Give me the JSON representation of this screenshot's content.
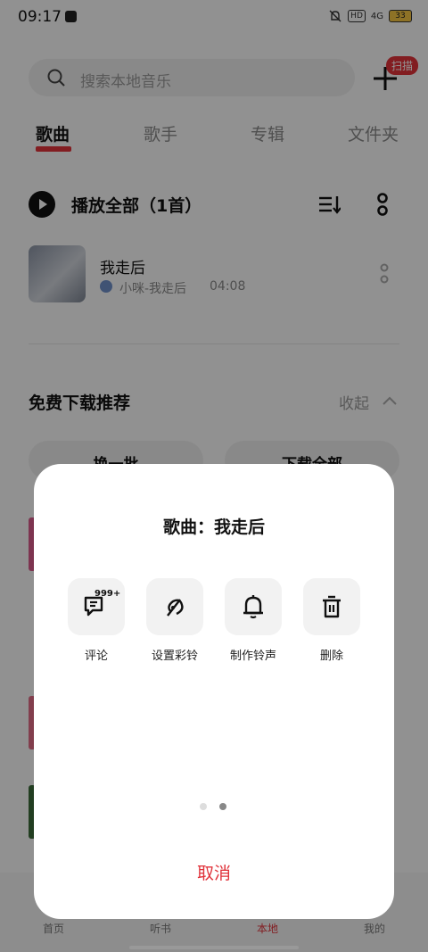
{
  "status_bar": {
    "time": "09:17",
    "hd": "HD",
    "network": "4G",
    "battery": "33"
  },
  "search": {
    "placeholder": "搜索本地音乐",
    "scan_badge": "扫描"
  },
  "tabs": [
    {
      "label": "歌曲"
    },
    {
      "label": "歌手"
    },
    {
      "label": "专辑"
    },
    {
      "label": "文件夹"
    }
  ],
  "play_all": {
    "label": "播放全部（1首）"
  },
  "song": {
    "title": "我走后",
    "artist": "小咪-我走后",
    "duration": "04:08"
  },
  "recommend": {
    "title": "免费下载推荐",
    "collapse_label": "收起",
    "buttons": [
      "换一批",
      "下载全部"
    ]
  },
  "bottom_nav": [
    {
      "label": "首页"
    },
    {
      "label": "听书"
    },
    {
      "label": "本地"
    },
    {
      "label": "我的"
    }
  ],
  "sheet": {
    "title": "歌曲：我走后",
    "actions": [
      {
        "label": "评论",
        "icon": "comment-icon",
        "badge": "999+"
      },
      {
        "label": "设置彩铃",
        "icon": "ringback-icon"
      },
      {
        "label": "制作铃声",
        "icon": "bell-icon"
      },
      {
        "label": "删除",
        "icon": "trash-icon"
      }
    ],
    "page_count": 2,
    "current_page": 2,
    "cancel_label": "取消"
  },
  "colors": {
    "accent": "#e0323a",
    "sheet_bg": "#ffffff",
    "overlay": "rgba(0,0,0,0.42)"
  }
}
